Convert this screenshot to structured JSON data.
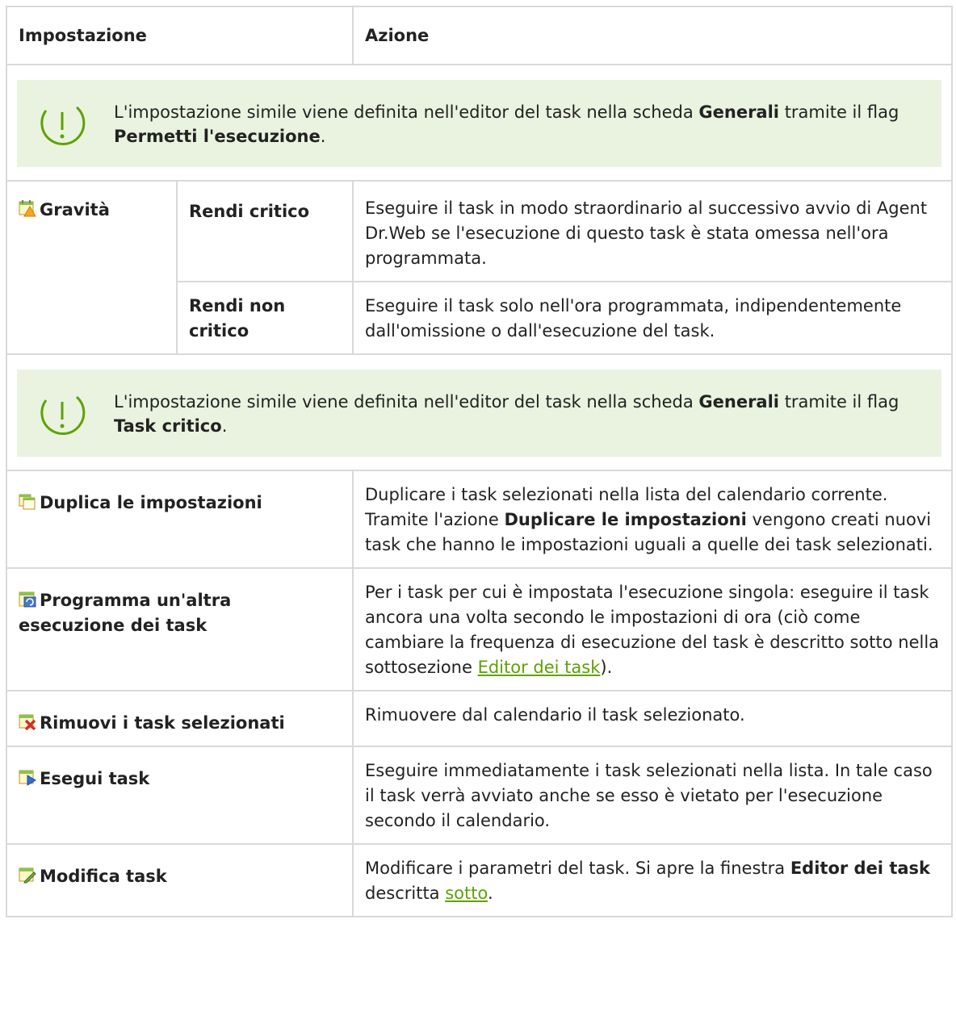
{
  "header": {
    "col1": "Impostazione",
    "col2": "Azione"
  },
  "note1": {
    "icon": "exclamation-circle-icon",
    "t1": "L'impostazione simile viene definita nell'editor del task nella scheda ",
    "b1": "Generali",
    "t2": " tramite il flag ",
    "b2": "Permetti l'esecuzione",
    "t3": "."
  },
  "gravita": {
    "icon": "calendar-warning-icon",
    "label": "Gravità",
    "critical": {
      "label": "Rendi critico",
      "action": "Eseguire il task in modo straordinario al successivo avvio di Agent Dr.Web se l'esecuzione di questo task è stata omessa nell'ora programmata."
    },
    "noncritical": {
      "label": "Rendi non critico",
      "action": "Eseguire il task solo nell'ora programmata, indipendentemente dall'omissione o dall'esecuzione del task."
    }
  },
  "note2": {
    "icon": "exclamation-circle-icon",
    "t1": "L'impostazione simile viene definita nell'editor del task nella scheda ",
    "b1": "Generali",
    "t2": " tramite il flag ",
    "b2": "Task critico",
    "t3": "."
  },
  "duplica": {
    "icon": "calendar-copy-icon",
    "label": "Duplica le impostazioni",
    "t1": "Duplicare i task selezionati nella lista del calendario corrente. Tramite l'azione ",
    "b1": "Duplicare le impostazioni",
    "t2": " vengono creati nuovi task che hanno le impostazioni uguali a quelle dei task selezionati."
  },
  "programma": {
    "icon": "calendar-repeat-icon",
    "label": "Programma un'altra esecuzione dei task",
    "t1": "Per i task per cui è impostata l'esecuzione singola: eseguire il task ancora una volta secondo le impostazioni di ora (ciò come cambiare la frequenza di esecuzione del task è descritto sotto nella sottosezione ",
    "link": "Editor dei task",
    "t2": ")."
  },
  "rimuovi": {
    "icon": "calendar-delete-icon",
    "label": "Rimuovi i task selezionati",
    "action": "Rimuovere dal calendario il task selezionato."
  },
  "esegui": {
    "icon": "calendar-run-icon",
    "label": "Esegui task",
    "action": "Eseguire immediatamente i task selezionati nella lista. In tale caso il task verrà avviato anche se esso è vietato per l'esecuzione secondo il calendario."
  },
  "modifica": {
    "icon": "calendar-edit-icon",
    "label": "Modifica task",
    "t1": "Modificare i parametri del task. Si apre la finestra ",
    "b1": "Editor dei task",
    "t2": " descritta ",
    "link": "sotto",
    "t3": "."
  },
  "colors": {
    "border": "#d9d9d9",
    "note_bg": "#e9f3e0",
    "accent": "#5ea200"
  }
}
